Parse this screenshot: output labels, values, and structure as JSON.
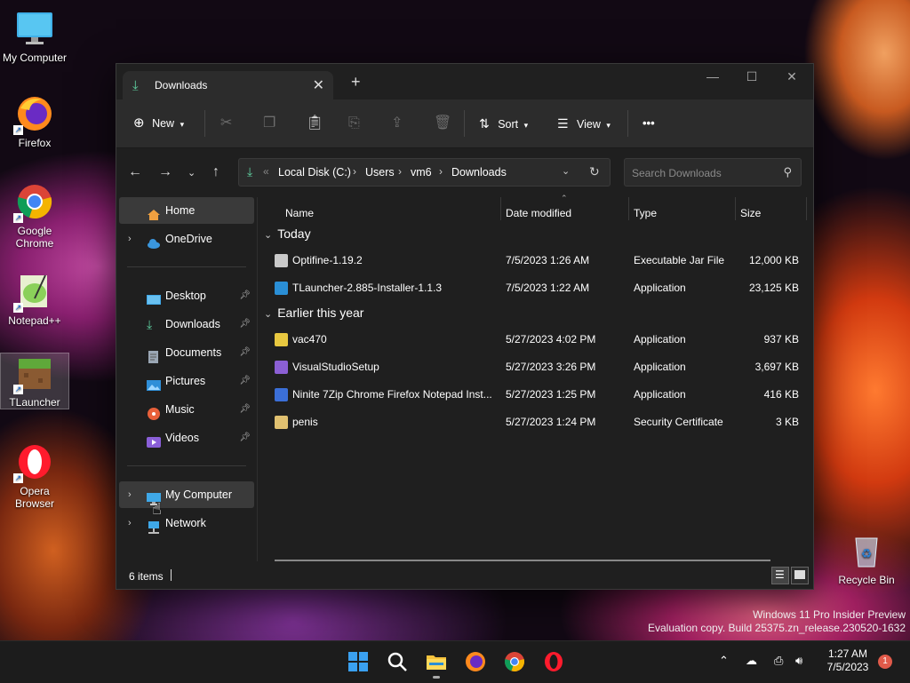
{
  "desktop": {
    "icons": [
      {
        "label": "My Computer"
      },
      {
        "label": "Firefox"
      },
      {
        "label": "Google Chrome"
      },
      {
        "label": "Notepad++"
      },
      {
        "label": "TLauncher"
      },
      {
        "label": "Opera Browser"
      },
      {
        "label": "Recycle Bin"
      }
    ],
    "watermark_line1": "Windows 11 Pro Insider Preview",
    "watermark_line2": "Evaluation copy. Build 25375.zn_release.230520-1632"
  },
  "window": {
    "tab_title": "Downloads",
    "toolbar": {
      "new_label": "New",
      "sort_label": "Sort",
      "view_label": "View",
      "more_label": "•••"
    },
    "breadcrumb": [
      "Local Disk (C:)",
      "Users",
      "vm6",
      "Downloads"
    ],
    "search_placeholder": "Search Downloads",
    "sidebar": {
      "home": "Home",
      "onedrive": "OneDrive",
      "quick": [
        "Desktop",
        "Downloads",
        "Documents",
        "Pictures",
        "Music",
        "Videos"
      ],
      "my_computer": "My Computer",
      "network": "Network"
    },
    "columns": {
      "name": "Name",
      "date": "Date modified",
      "type": "Type",
      "size": "Size"
    },
    "groups": [
      {
        "title": "Today",
        "files": [
          {
            "name": "Optifine-1.19.2",
            "date": "7/5/2023 1:26 AM",
            "type": "Executable Jar File",
            "size": "12,000 KB",
            "color": "#c9c9c9"
          },
          {
            "name": "TLauncher-2.885-Installer-1.1.3",
            "date": "7/5/2023 1:22 AM",
            "type": "Application",
            "size": "23,125 KB",
            "color": "#2a8fd6"
          }
        ]
      },
      {
        "title": "Earlier this year",
        "files": [
          {
            "name": "vac470",
            "date": "5/27/2023 4:02 PM",
            "type": "Application",
            "size": "937 KB",
            "color": "#e8c840"
          },
          {
            "name": "VisualStudioSetup",
            "date": "5/27/2023 3:26 PM",
            "type": "Application",
            "size": "3,697 KB",
            "color": "#8b5fd4"
          },
          {
            "name": "Ninite 7Zip Chrome Firefox Notepad Inst...",
            "date": "5/27/2023 1:25 PM",
            "type": "Application",
            "size": "416 KB",
            "color": "#3b6fd8"
          },
          {
            "name": "penis",
            "date": "5/27/2023 1:24 PM",
            "type": "Security Certificate",
            "size": "3 KB",
            "color": "#e0c070"
          }
        ]
      }
    ],
    "status": {
      "item_count": "6 items"
    }
  },
  "taskbar": {
    "time": "1:27 AM",
    "date": "7/5/2023",
    "notification_count": "1",
    "apps": [
      "start-icon",
      "search-icon",
      "file-explorer-icon",
      "firefox-icon",
      "chrome-icon",
      "opera-icon"
    ]
  }
}
